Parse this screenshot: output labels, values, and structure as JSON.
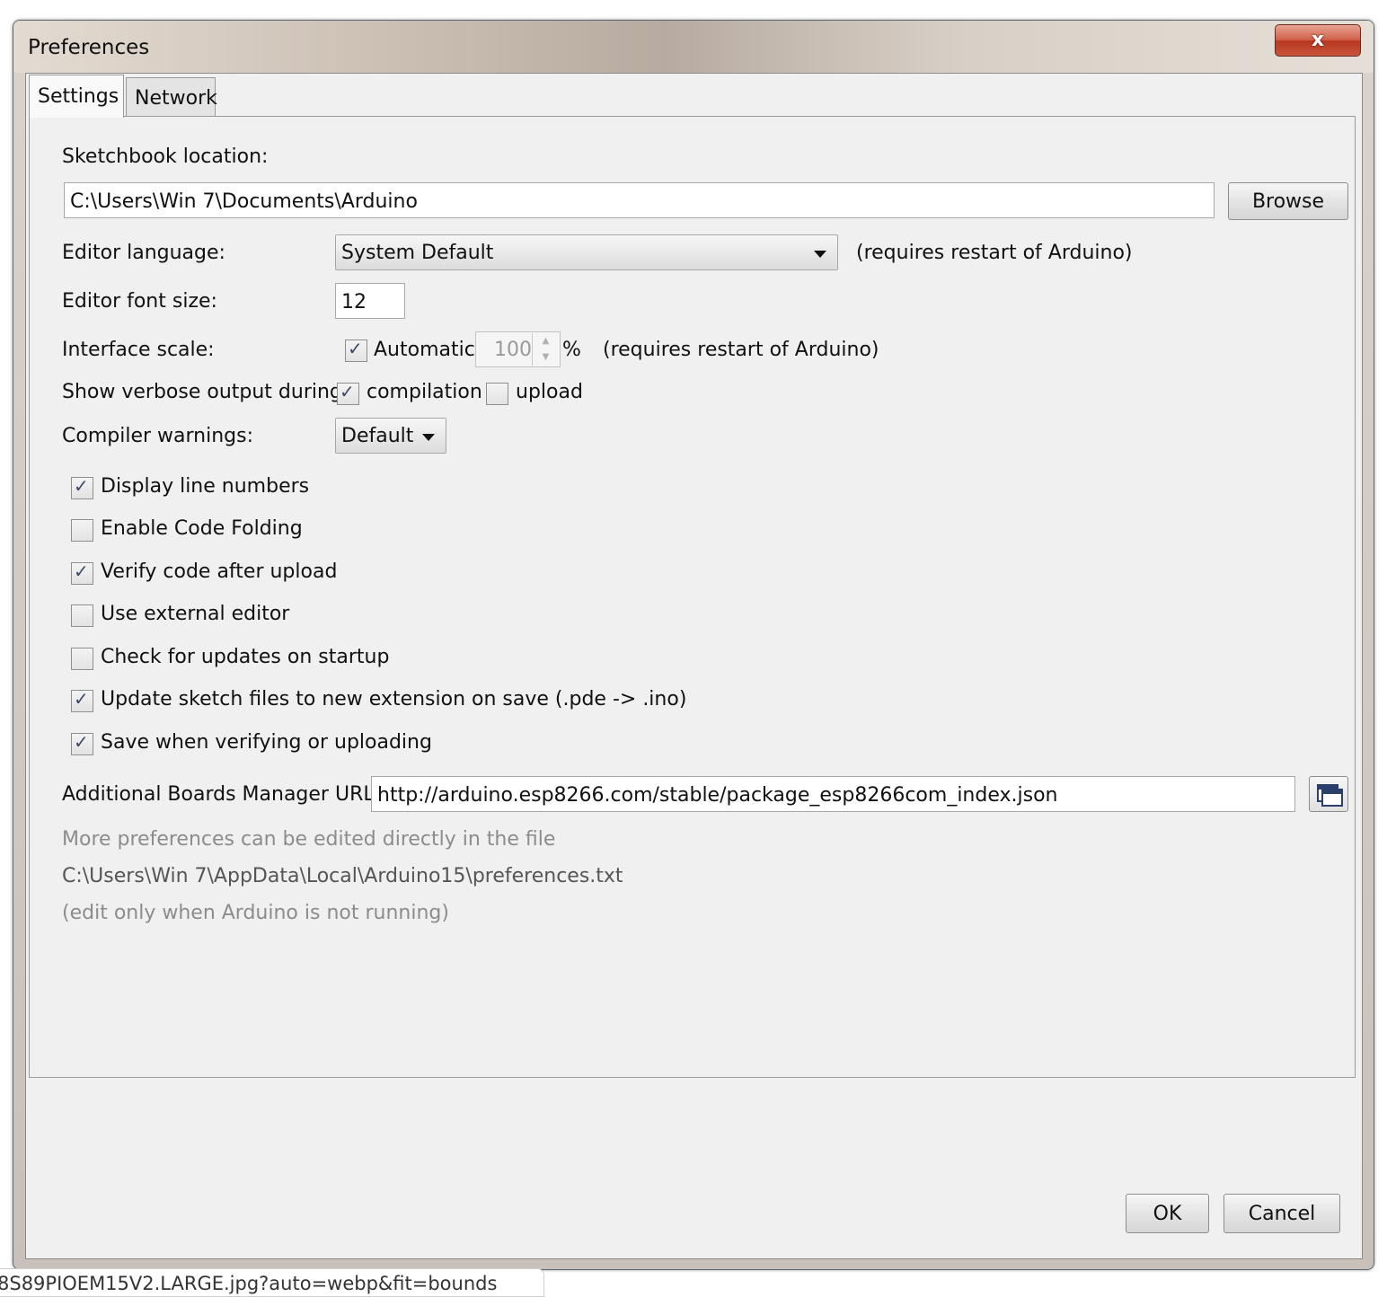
{
  "window": {
    "title": "Preferences",
    "close_label": "x"
  },
  "tabs": [
    {
      "label": "Settings",
      "active": true
    },
    {
      "label": "Network",
      "active": false
    }
  ],
  "settings": {
    "sketchbook_label": "Sketchbook location:",
    "sketchbook_path": "C:\\Users\\Win 7\\Documents\\Arduino",
    "browse_label": "Browse",
    "editor_language_label": "Editor language:",
    "editor_language_value": "System Default",
    "editor_language_note": "(requires restart of Arduino)",
    "font_size_label": "Editor font size:",
    "font_size_value": "12",
    "interface_scale_label": "Interface scale:",
    "automatic_label": "Automatic",
    "automatic_checked": true,
    "scale_value": "100",
    "scale_unit": "%",
    "scale_note": "(requires restart of Arduino)",
    "verbose_label": "Show verbose output during:",
    "compilation_label": "compilation",
    "compilation_checked": true,
    "upload_label": "upload",
    "upload_checked": false,
    "warnings_label": "Compiler warnings:",
    "warnings_value": "Default",
    "options": [
      {
        "label": "Display line numbers",
        "checked": true
      },
      {
        "label": "Enable Code Folding",
        "checked": false
      },
      {
        "label": "Verify code after upload",
        "checked": true
      },
      {
        "label": "Use external editor",
        "checked": false
      },
      {
        "label": "Check for updates on startup",
        "checked": false
      },
      {
        "label": "Update sketch files to new extension on save (.pde -> .ino)",
        "checked": true
      },
      {
        "label": "Save when verifying or uploading",
        "checked": true
      }
    ],
    "boards_urls_label": "Additional Boards Manager URLs:",
    "boards_urls_value": "http://arduino.esp8266.com/stable/package_esp8266com_index.json",
    "more_prefs_note": "More preferences can be edited directly in the file",
    "prefs_file_path": "C:\\Users\\Win 7\\AppData\\Local\\Arduino15\\preferences.txt",
    "edit_note": "(edit only when Arduino is not running)"
  },
  "footer": {
    "ok_label": "OK",
    "cancel_label": "Cancel"
  },
  "status_url": "8S89PIOEM15V2.LARGE.jpg?auto=webp&fit=bounds",
  "colors": {
    "window_bg": "#f0f0f0",
    "close_button": "#c7553c",
    "checkmark": "#3a4a63",
    "muted_text": "#8c8c8c"
  }
}
